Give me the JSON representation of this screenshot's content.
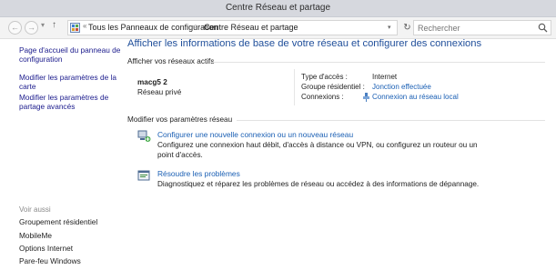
{
  "window": {
    "title": "Centre Réseau et partage"
  },
  "address_bar": {
    "overflow_marker": "«",
    "crumbs": [
      "Tous les Panneaux de configuration",
      "Centre Réseau et partage"
    ],
    "separator": "›",
    "search_placeholder": "Rechercher"
  },
  "sidebar": {
    "home_link_line1": "Page d'accueil du panneau de",
    "home_link_line2": "configuration",
    "adapter_link_line1": "Modifier les paramètres de la",
    "adapter_link_line2": "carte",
    "sharing_link_line1": "Modifier les paramètres de",
    "sharing_link_line2": "partage avancés",
    "see_also": "Voir aussi",
    "see_also_items": [
      "Groupement résidentiel",
      "MobileMe",
      "Options Internet",
      "Pare-feu Windows"
    ]
  },
  "main": {
    "heading": "Afficher les informations de base de votre réseau et configurer des connexions",
    "active_networks_label": "Afficher vos réseaux actifs",
    "network": {
      "name": "macg5  2",
      "category": "Réseau privé",
      "access_type_label": "Type d'accès :",
      "access_type_value": "Internet",
      "homegroup_label": "Groupe résidentiel :",
      "homegroup_value": "Jonction effectuée",
      "connections_label": "Connexions :",
      "connections_value": "Connexion au réseau local"
    },
    "modify_label": "Modifier vos paramètres réseau",
    "tasks": [
      {
        "title": "Configurer une nouvelle connexion ou un nouveau réseau",
        "desc_line1": "Configurez une connexion haut débit, d'accès à distance ou VPN, ou configurez un routeur ou un",
        "desc_line2": "point d'accès."
      },
      {
        "title": "Résoudre les problèmes",
        "desc_line1": "Diagnostiquez et réparez les problèmes de réseau ou accédez à des informations de dépannage.",
        "desc_line2": ""
      }
    ]
  },
  "colors": {
    "link": "#1a5fb4",
    "heading": "#1f4e9a",
    "titlebar": "#d6d8de"
  },
  "icons": [
    "back-icon",
    "forward-icon",
    "up-arrow-icon",
    "control-panel-icon",
    "refresh-icon",
    "search-icon",
    "network-adapter-icon",
    "new-connection-icon",
    "troubleshoot-icon"
  ]
}
